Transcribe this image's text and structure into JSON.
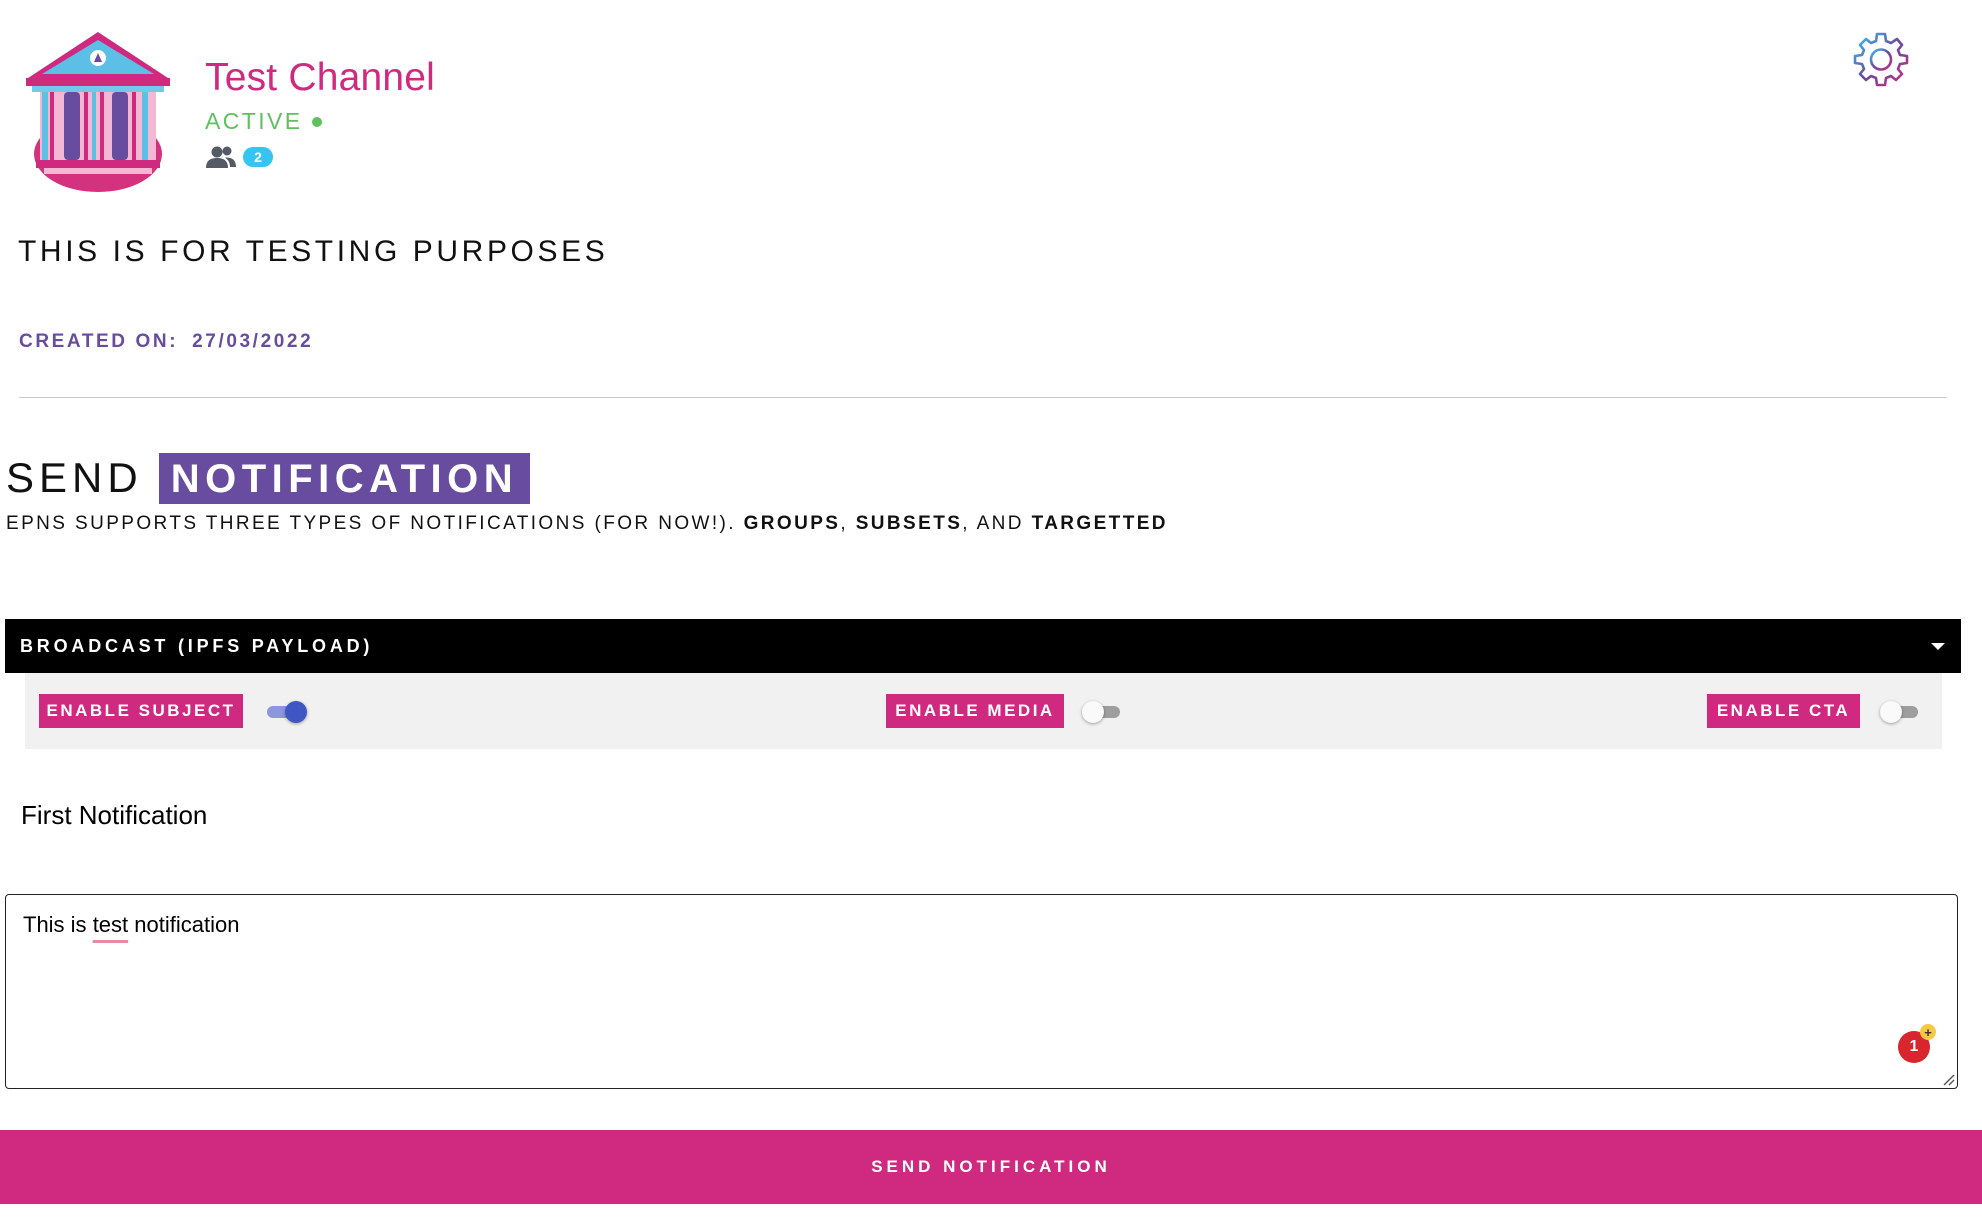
{
  "channel": {
    "name": "Test Channel",
    "status": "ACTIVE",
    "subscriber_count": "2",
    "description": "THIS IS FOR TESTING PURPOSES",
    "created_label": "CREATED ON:",
    "created_date": "27/03/2022",
    "icons": {
      "logo": "bank-building-logo",
      "subscribers": "people-icon",
      "settings": "gear-icon"
    },
    "colors": {
      "name": "#cf2a80",
      "status": "#5fc05f",
      "badge": "#35c5f3"
    }
  },
  "send": {
    "title_plain": "SEND",
    "title_highlight": "NOTIFICATION",
    "subtitle_prefix": "EPNS SUPPORTS THREE TYPES OF NOTIFICATIONS (FOR NOW!).",
    "subtitle_groups": "GROUPS",
    "subtitle_comma": ",",
    "subtitle_subsets": "SUBSETS",
    "subtitle_and": ", AND",
    "subtitle_targetted": "TARGETTED",
    "type_selected": "BROADCAST (IPFS PAYLOAD)",
    "options": [
      {
        "label": "ENABLE SUBJECT",
        "enabled": true
      },
      {
        "label": "ENABLE MEDIA",
        "enabled": false
      },
      {
        "label": "ENABLE CTA",
        "enabled": false
      }
    ],
    "subject_value": "First Notification",
    "message_before": "This is ",
    "message_misspelled": "test",
    "message_after": " notification",
    "extension_badge_count": "1",
    "extension_badge_plus": "+",
    "submit_label": "SEND NOTIFICATION",
    "colors": {
      "accent": "#cf2a80",
      "purple": "#674c9f",
      "toggle_on": "#4056c3"
    }
  }
}
